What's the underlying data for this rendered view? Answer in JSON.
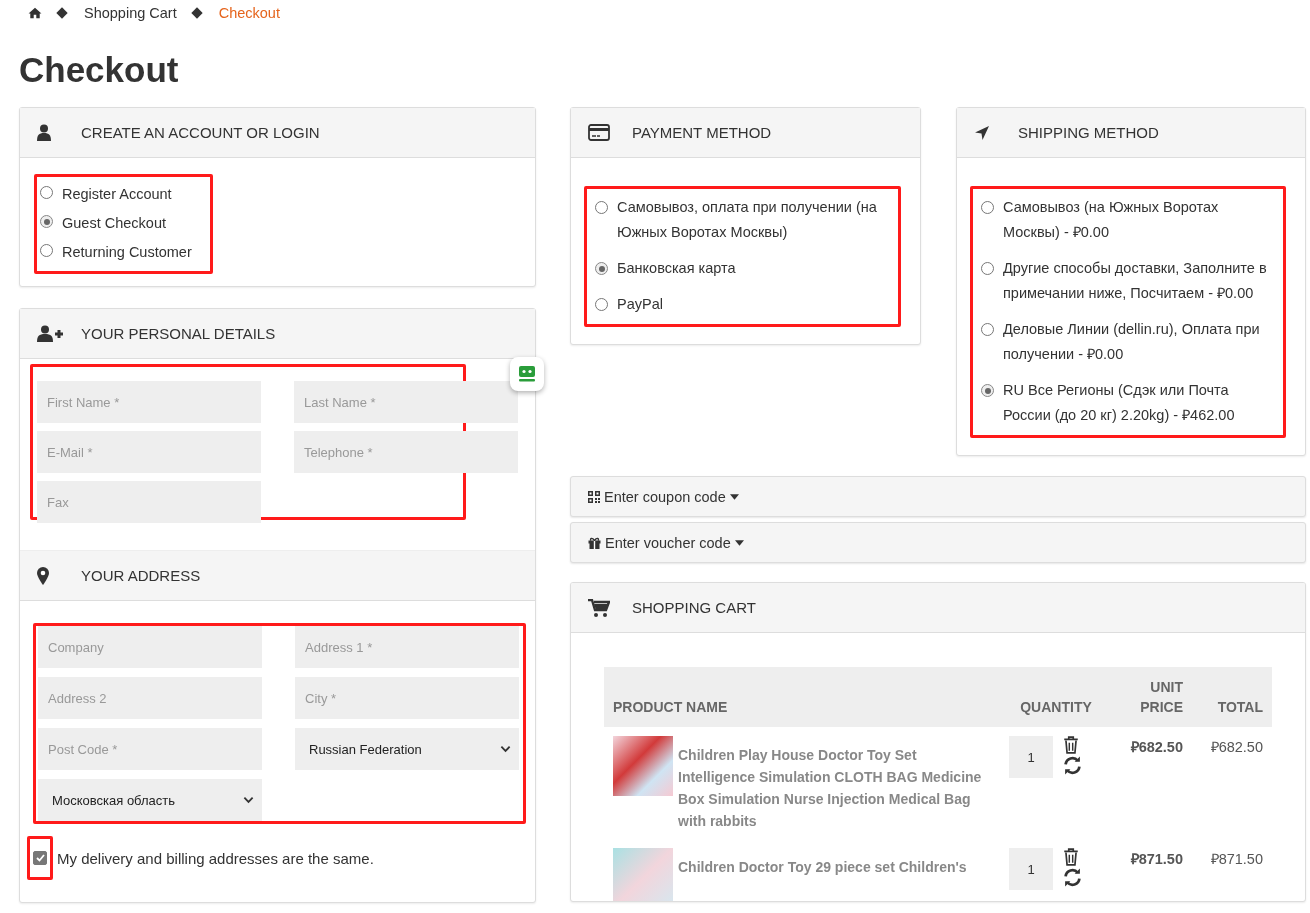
{
  "breadcrumb": [
    {
      "kind": "home"
    },
    {
      "kind": "link",
      "label": "Shopping Cart"
    },
    {
      "kind": "current",
      "label": "Checkout"
    }
  ],
  "title": "Checkout",
  "account": {
    "title": "CREATE AN ACCOUNT OR LOGIN",
    "highlighted": true,
    "options": [
      {
        "label": "Register Account",
        "selected": false
      },
      {
        "label": "Guest Checkout",
        "selected": true
      },
      {
        "label": "Returning Customer",
        "selected": false
      }
    ]
  },
  "personal": {
    "title": "YOUR PERSONAL DETAILS",
    "highlighted": true,
    "fields": [
      {
        "kind": "input",
        "placeholder": "First Name *"
      },
      {
        "kind": "input",
        "placeholder": "Last Name *"
      },
      {
        "kind": "input",
        "placeholder": "E-Mail *"
      },
      {
        "kind": "input",
        "placeholder": "Telephone *"
      },
      {
        "kind": "input",
        "placeholder": "Fax"
      }
    ]
  },
  "address": {
    "title": "YOUR ADDRESS",
    "highlighted": true,
    "fields": [
      {
        "kind": "input",
        "placeholder": "Company"
      },
      {
        "kind": "input",
        "placeholder": "Address 1 *"
      },
      {
        "kind": "input",
        "placeholder": "Address 2"
      },
      {
        "kind": "input",
        "placeholder": "City *"
      },
      {
        "kind": "input",
        "placeholder": "Post Code *"
      },
      {
        "kind": "select",
        "value": "Russian Federation"
      },
      {
        "kind": "select",
        "value": "Московская область"
      }
    ]
  },
  "same_address": {
    "label": "My delivery and billing addresses are the same.",
    "checked": true,
    "highlighted": true
  },
  "payment": {
    "title": "PAYMENT METHOD",
    "highlighted": true,
    "options": [
      {
        "label": "Самовывоз, оплата при получении (на Южных Воротах Москвы)",
        "selected": false
      },
      {
        "label": "Банковская карта",
        "selected": true
      },
      {
        "label": "PayPal",
        "selected": false
      }
    ]
  },
  "shipping": {
    "title": "SHIPPING METHOD",
    "highlighted": true,
    "options": [
      {
        "label": "Самовывоз (на Южных Воротах Москвы) - ₽0.00",
        "selected": false
      },
      {
        "label": "Другие способы доставки, Заполните в примечании ниже, Посчитаем - ₽0.00",
        "selected": false
      },
      {
        "label": "Деловые Линии (dellin.ru), Оплата при получении - ₽0.00",
        "selected": false
      },
      {
        "label": "RU Все Регионы (Сдэк или Почта России (до 20 кг) 2.20kg) - ₽462.00",
        "selected": true
      }
    ]
  },
  "coupon": {
    "label": "Enter coupon code"
  },
  "voucher": {
    "label": "Enter voucher code"
  },
  "cart": {
    "title": "SHOPPING CART",
    "columns": [
      "PRODUCT NAME",
      "QUANTITY",
      "UNIT PRICE",
      "TOTAL"
    ],
    "rows": [
      {
        "name": "Children Play House Doctor Toy Set Intelligence Simulation CLOTH BAG Medicine Box Simulation Nurse Injection Medical Bag with rabbits",
        "quantity": "1",
        "unit_price": "₽682.50",
        "total": "₽682.50"
      },
      {
        "name": "Children Doctor Toy 29 piece set Children's",
        "quantity": "1",
        "unit_price": "₽871.50",
        "total": "₽871.50"
      }
    ]
  }
}
